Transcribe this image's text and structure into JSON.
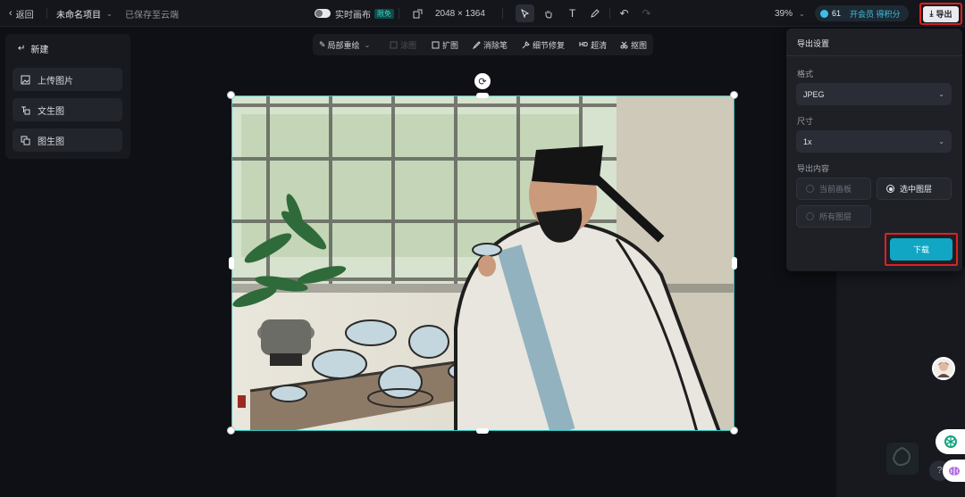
{
  "topbar": {
    "back_label": "返回",
    "project_name": "未命名项目",
    "save_status": "已保存至云端",
    "realtime_label": "实时画布",
    "free_badge": "限免",
    "canvas_size": "2048 × 1364",
    "zoom": "39%",
    "credits_count": "61",
    "member_label": "开会员 得积分",
    "export_label": "导出"
  },
  "left_panel": {
    "new_label": "新建",
    "items": [
      {
        "label": "上传图片",
        "icon": "upload-image-icon"
      },
      {
        "label": "文生图",
        "icon": "text-to-image-icon"
      },
      {
        "label": "图生图",
        "icon": "image-to-image-icon"
      }
    ]
  },
  "subtoolbar": {
    "items": [
      {
        "label": "局部重绘",
        "icon": "brush-icon"
      },
      {
        "label": "涂图",
        "icon": "erase-icon"
      },
      {
        "label": "扩图",
        "icon": "expand-icon"
      },
      {
        "label": "消除笔",
        "icon": "eraser-pen-icon"
      },
      {
        "label": "细节修复",
        "icon": "detail-fix-icon"
      },
      {
        "label": "超清",
        "icon": "hd-icon",
        "prefix": "HD"
      },
      {
        "label": "抠图",
        "icon": "cutout-icon"
      }
    ]
  },
  "export_panel": {
    "title": "导出设置",
    "format_label": "格式",
    "format_value": "JPEG",
    "size_label": "尺寸",
    "size_value": "1x",
    "content_label": "导出内容",
    "options": [
      {
        "label": "当前画板",
        "selected": false
      },
      {
        "label": "选中图层",
        "selected": true
      },
      {
        "label": "所有图层",
        "selected": false
      }
    ],
    "download_label": "下载"
  },
  "colors": {
    "accent": "#10a6c4",
    "selection": "#2ec6c0",
    "highlight_box": "#e02020"
  }
}
